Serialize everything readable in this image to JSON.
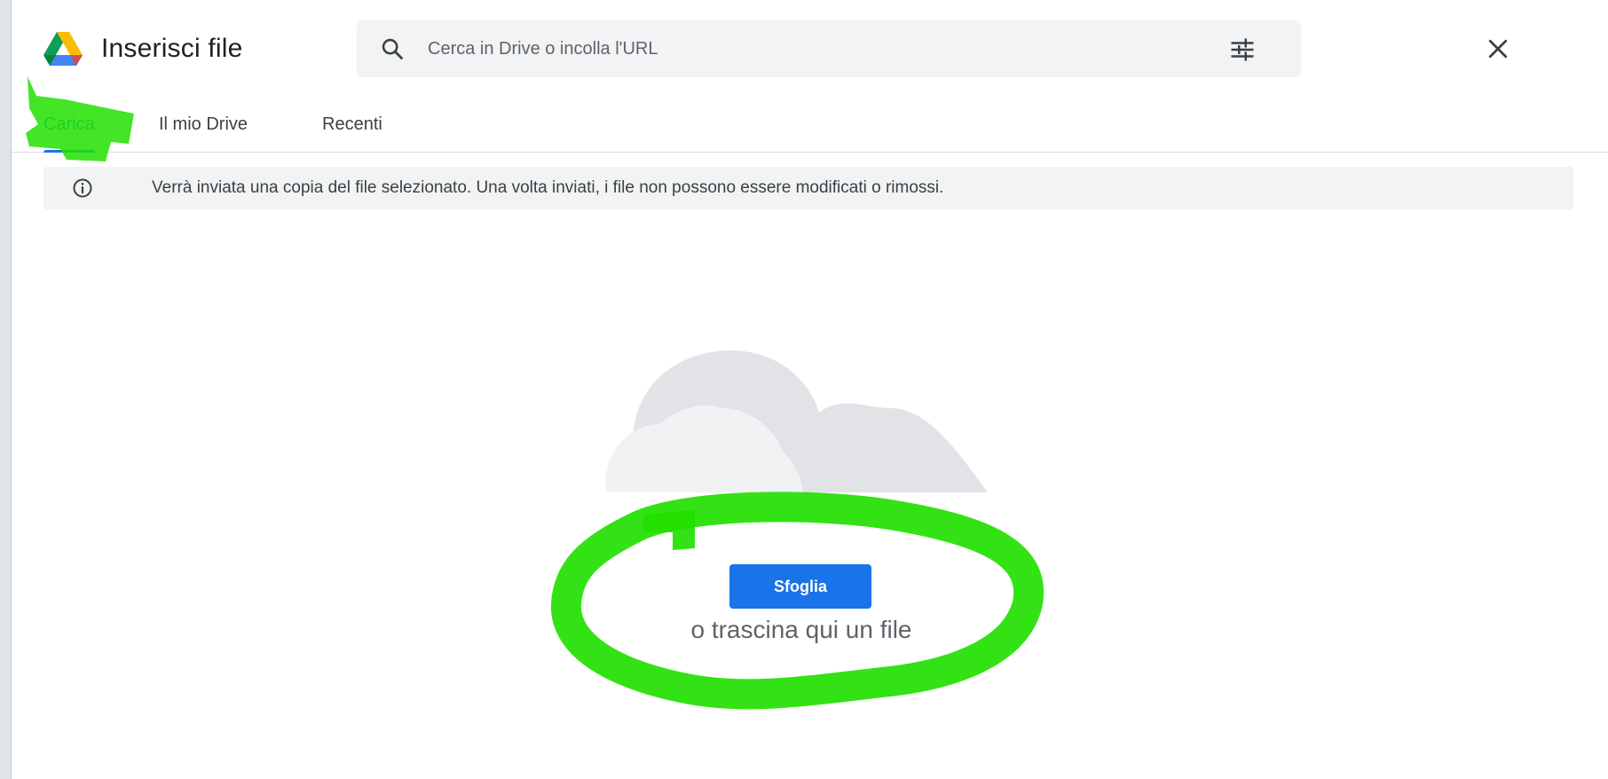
{
  "header": {
    "title": "Inserisci file",
    "logo_icon": "google-drive-icon",
    "search_placeholder": "Cerca in Drive o incolla l'URL",
    "search_icon": "search-icon",
    "filter_icon": "tune-filter-icon",
    "close_icon": "close-icon"
  },
  "tabs": [
    {
      "label": "Carica",
      "active": true
    },
    {
      "label": "Il mio Drive",
      "active": false
    },
    {
      "label": "Recenti",
      "active": false
    }
  ],
  "notice": {
    "icon": "info-icon",
    "text": "Verrà inviata una copia del file selezionato. Una volta inviati, i file non possono essere modificati o rimossi."
  },
  "upload": {
    "illustration": "cloud-icon",
    "browse_label": "Sfoglia",
    "drop_text": "o trascina qui un file"
  },
  "colors": {
    "accent": "#1a73e8",
    "annotation_highlight": "#22e000",
    "notice_bg": "#f1f3f4"
  }
}
